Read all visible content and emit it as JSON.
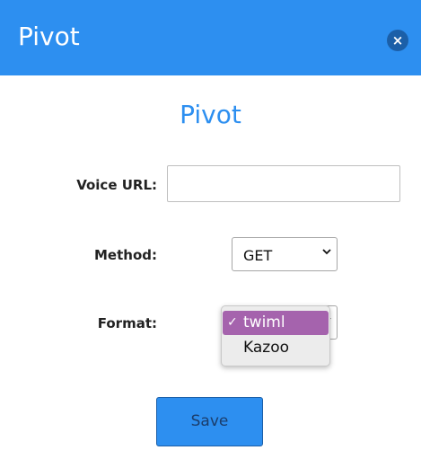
{
  "header": {
    "title": "Pivot",
    "close_icon": "close-icon",
    "close_glyph": "×",
    "background": "#2d8ff0"
  },
  "form": {
    "heading": "Pivot",
    "voice_url": {
      "label": "Voice URL:",
      "value": ""
    },
    "method": {
      "label": "Method:",
      "selected": "GET"
    },
    "format": {
      "label": "Format:",
      "options": [
        {
          "label": "twiml",
          "checked": true
        },
        {
          "label": "Kazoo",
          "checked": false
        }
      ],
      "check_glyph": "✓"
    },
    "save_label": "Save"
  },
  "colors": {
    "accent": "#2d8ff0",
    "selected_option": "#a563ad"
  }
}
